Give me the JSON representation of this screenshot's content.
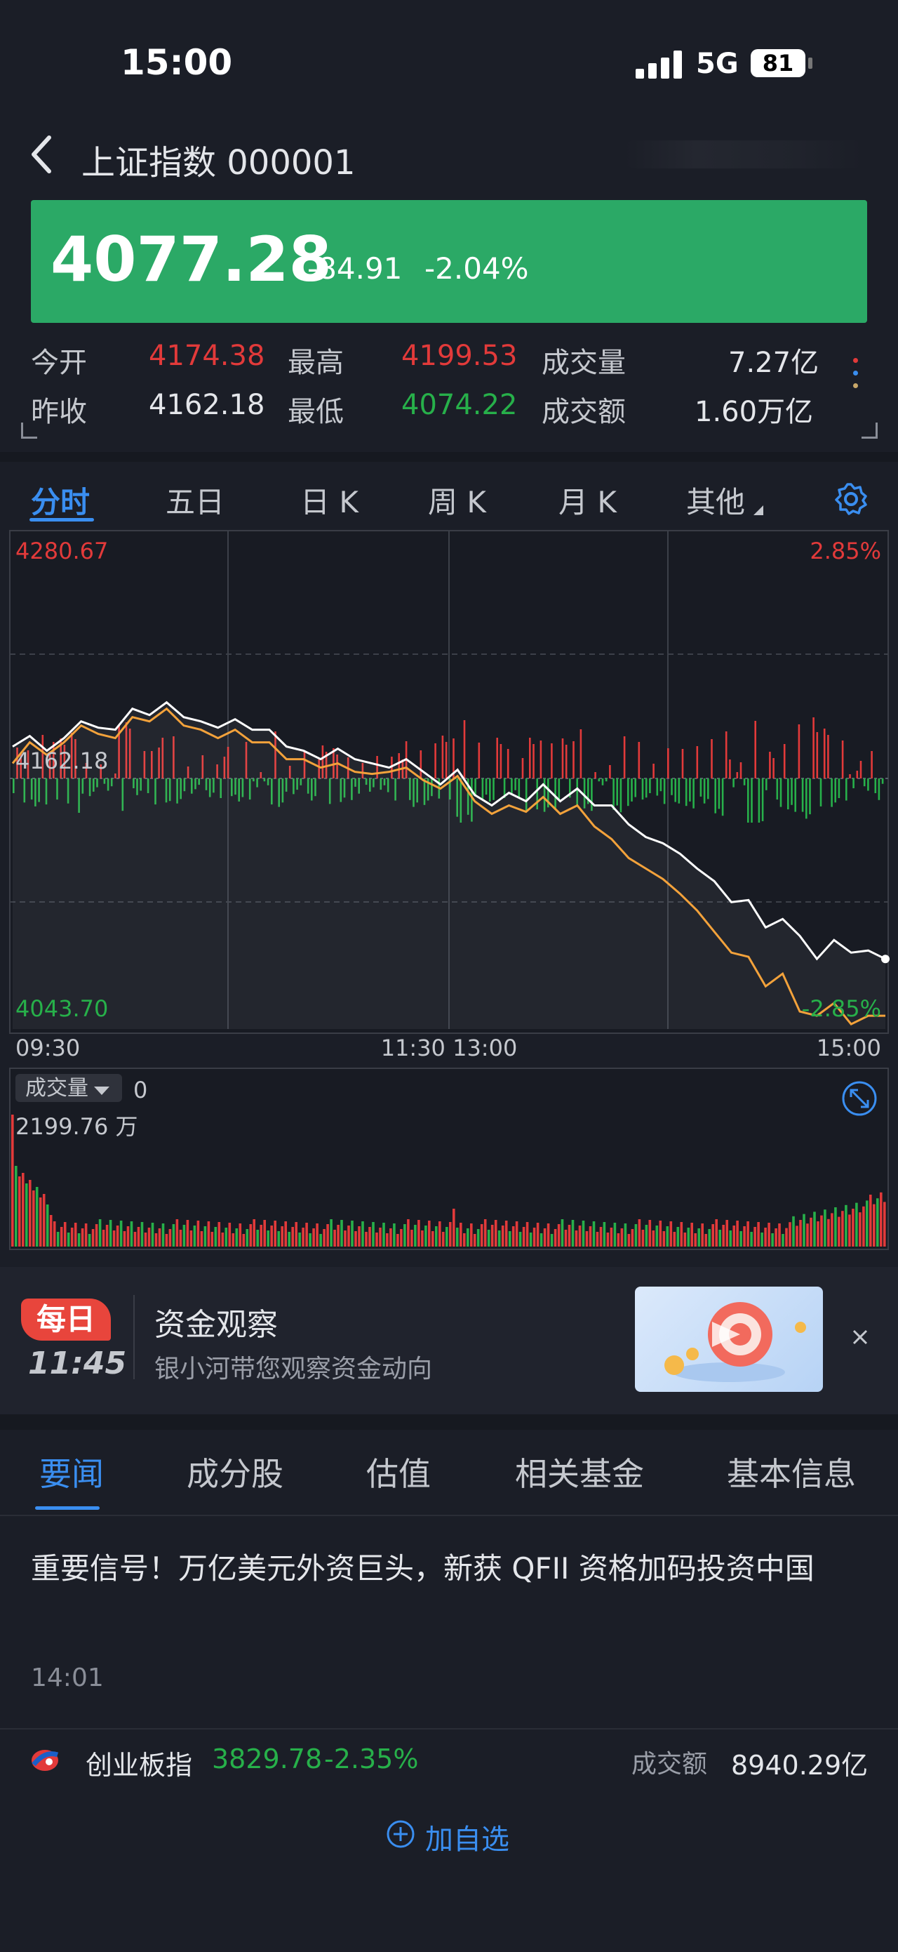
{
  "status_bar": {
    "time": "15:00",
    "network": "5G",
    "battery": "81"
  },
  "nav": {
    "title": "上证指数 000001"
  },
  "quote": {
    "price": "4077.28",
    "change": "-84.91",
    "change_pct": "-2.04%"
  },
  "stats": [
    [
      {
        "label": "今开",
        "value": "4174.38",
        "tone": "red"
      },
      {
        "label": "最高",
        "value": "4199.53",
        "tone": "red"
      },
      {
        "label": "成交量",
        "value": "7.27亿",
        "tone": "white"
      }
    ],
    [
      {
        "label": "昨收",
        "value": "4162.18",
        "tone": "white"
      },
      {
        "label": "最低",
        "value": "4074.22",
        "tone": "green"
      },
      {
        "label": "成交额",
        "value": "1.60万亿",
        "tone": "white"
      }
    ]
  ],
  "chart_tabs": [
    "分时",
    "五日",
    "日 K",
    "周 K",
    "月 K",
    "其他"
  ],
  "chart_data": {
    "type": "line",
    "y_top": "4280.67",
    "y_top_pct": "2.85%",
    "y_mid": "4162.18",
    "y_bottom": "4043.70",
    "y_bottom_pct": "-2.85%",
    "ylim": [
      4043.7,
      4280.67
    ],
    "x_labels": [
      "09:30",
      "11:30 13:00",
      "15:00"
    ],
    "series": [
      {
        "values": [
          4178,
          4183,
          4176,
          4182,
          4190,
          4187,
          4186,
          4196,
          4193,
          4199,
          4192,
          4190,
          4187,
          4191,
          4186,
          4186,
          4178,
          4176,
          4172,
          4177,
          4172,
          4170,
          4168,
          4172,
          4166,
          4160,
          4167,
          4155,
          4150,
          4156,
          4152,
          4160,
          4152,
          4158,
          4150,
          4150,
          4141,
          4135,
          4132,
          4127,
          4120,
          4114,
          4104,
          4105,
          4092,
          4096,
          4088,
          4077,
          4086,
          4080,
          4081,
          4077
        ]
      },
      {
        "values": [
          4170,
          4180,
          4174,
          4180,
          4188,
          4184,
          4182,
          4192,
          4190,
          4196,
          4188,
          4186,
          4182,
          4186,
          4180,
          4180,
          4172,
          4172,
          4168,
          4170,
          4166,
          4165,
          4166,
          4168,
          4162,
          4158,
          4164,
          4152,
          4146,
          4150,
          4147,
          4154,
          4146,
          4150,
          4140,
          4134,
          4125,
          4120,
          4115,
          4108,
          4100,
          4090,
          4080,
          4078,
          4064,
          4070,
          4052,
          4050,
          4056,
          4046,
          4050,
          4050
        ]
      }
    ],
    "volume_label": "成交量",
    "volume_value": "0",
    "volume_max": "2199.76 万"
  },
  "promo": {
    "badge": "每日",
    "time": "11:45",
    "title": "资金观察",
    "subtitle": "银小河带您观察资金动向"
  },
  "news_tabs": [
    "要闻",
    "成分股",
    "估值",
    "相关基金",
    "基本信息"
  ],
  "news": {
    "headline": "重要信号！万亿美元外资巨头，新获 QFII 资格加码投资中国",
    "time": "14:01"
  },
  "related": {
    "name": "创业板指",
    "price": "3829.78",
    "pct": "-2.35%",
    "turnover_label": "成交额",
    "turnover": "8940.29亿"
  },
  "add_watch": "加自选",
  "colors": {
    "up": "#e23a3a",
    "down": "#27b04a",
    "accent": "#3a8ef0",
    "banner": "#2ba966"
  }
}
